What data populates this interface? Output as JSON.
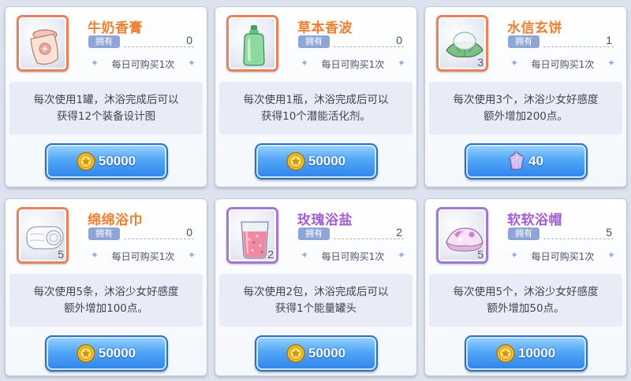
{
  "shop": {
    "owned_label": "拥有",
    "daily_label": "每日可购买1次",
    "items": [
      {
        "name": "牛奶香膏",
        "owned": "0",
        "stack": "",
        "desc1": "每次使用1罐，沐浴完成后可以",
        "desc2": "获得12个装备设计图",
        "price": "50000",
        "currency": "coin",
        "rarity": "orange",
        "icon": "cream-jar-icon"
      },
      {
        "name": "草本香波",
        "owned": "0",
        "stack": "",
        "desc1": "每次使用1瓶，沐浴完成后可以",
        "desc2": "获得10个潜能活化剂。",
        "price": "50000",
        "currency": "coin",
        "rarity": "orange",
        "icon": "shampoo-bottle-icon"
      },
      {
        "name": "水信玄饼",
        "owned": "1",
        "stack": "3",
        "desc1": "每次使用3个，沐浴少女好感度",
        "desc2": "额外增加200点。",
        "price": "40",
        "currency": "gem",
        "rarity": "orange",
        "icon": "raindrop-cake-icon"
      },
      {
        "name": "绵绵浴巾",
        "owned": "0",
        "stack": "5",
        "desc1": "每次使用5条，沐浴少女好感度",
        "desc2": "额外增加100点。",
        "price": "50000",
        "currency": "coin",
        "rarity": "orange",
        "icon": "towel-icon"
      },
      {
        "name": "玫瑰浴盐",
        "owned": "2",
        "stack": "2",
        "desc1": "每次使用2包，沐浴完成后可以",
        "desc2": "获得1个能量罐头",
        "price": "50000",
        "currency": "coin",
        "rarity": "purple",
        "icon": "bath-salt-icon"
      },
      {
        "name": "软软浴帽",
        "owned": "5",
        "stack": "5",
        "desc1": "每次使用5个，沐浴少女好感度",
        "desc2": "额外增加50点。",
        "price": "10000",
        "currency": "coin",
        "rarity": "purple",
        "icon": "shower-cap-icon"
      }
    ]
  },
  "colors": {
    "title_orange": "#ec8133",
    "title_purple": "#a45ed4",
    "frame_orange": "#e9815a",
    "frame_purple": "#a277d8",
    "button_blue": "#3b8ff0"
  }
}
